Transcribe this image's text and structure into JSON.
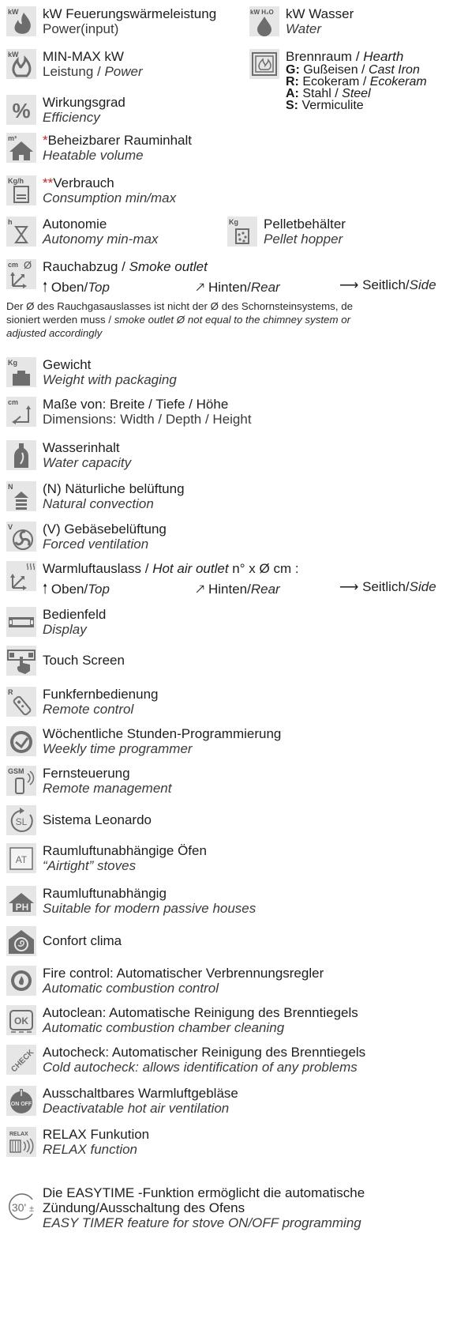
{
  "items": [
    {
      "title": "kW Feuerungswärmeleistung",
      "subtitle": "Power(input)",
      "icon": "flame-icon"
    },
    {
      "title": "MIN-MAX kW",
      "subtitle_a": "Leistung / ",
      "subtitle_b": "Power",
      "icon": "flames-icon"
    },
    {
      "title": "Wirkungsgrad",
      "subtitle": "Efficiency",
      "icon": "percent-icon"
    },
    {
      "title_mark": "*",
      "title": "Beheizbarer Rauminhalt",
      "subtitle": "Heatable volume",
      "icon": "house-icon"
    },
    {
      "title_mark": "**",
      "title": "Verbrauch",
      "subtitle": "Consumption min/max",
      "icon": "consumption-icon"
    },
    {
      "title": "Autonomie",
      "subtitle": "Autonomy min-max",
      "icon": "hourglass-icon"
    },
    {
      "title_a": "Rauchabzug / ",
      "title_b": "Smoke outlet",
      "icon": "smoke-outlet-icon"
    },
    {
      "title": "Gewicht",
      "subtitle": "Weight with packaging",
      "icon": "weight-icon"
    },
    {
      "title": "Maße von: Breite / Tiefe / Höhe",
      "subtitle": "Dimensions: Width / Depth / Height",
      "icon": "dimensions-icon"
    },
    {
      "title": "Wasserinhalt",
      "subtitle": "Water capacity",
      "icon": "water-bottle-icon"
    },
    {
      "title": "(N) Näturliche belüftung",
      "subtitle": "Natural convection",
      "icon": "natural-convection-icon"
    },
    {
      "title": "(V) Gebäsebelüftung",
      "subtitle": "Forced ventilation",
      "icon": "fan-icon"
    },
    {
      "title_a": "Warmluftauslass / ",
      "title_b": "Hot air outlet",
      "title_c": "  n° x Ø cm :",
      "icon": "hot-air-outlet-icon"
    },
    {
      "title": "Bedienfeld",
      "subtitle": "Display",
      "icon": "display-icon"
    },
    {
      "title": "Touch Screen",
      "icon": "touch-screen-icon"
    },
    {
      "title": "Funkfernbedienung",
      "subtitle": "Remote control",
      "icon": "remote-control-icon"
    },
    {
      "title": "Wöchentliche Stunden-Programmierung",
      "subtitle": "Weekly time programmer",
      "icon": "clock-icon"
    },
    {
      "title": "Fernsteuerung",
      "subtitle": "Remote management",
      "icon": "gsm-icon"
    },
    {
      "title": "Sistema Leonardo",
      "icon": "sl-icon"
    },
    {
      "title": "Raumluftunabhängige Öfen",
      "subtitle": "“Airtight” stoves",
      "icon": "airtight-icon"
    },
    {
      "title": "Raumluftunabhängig",
      "subtitle": "Suitable for modern passive houses",
      "icon": "passive-house-icon"
    },
    {
      "title": "Confort clima",
      "icon": "confort-clima-icon"
    },
    {
      "title": "Fire control: Automatischer Verbrennungsregler",
      "subtitle": "Automatic combustion control",
      "icon": "fire-control-icon"
    },
    {
      "title": "Autoclean: Automatische Reinigung des Brenntiegels",
      "subtitle": "Automatic combustion chamber cleaning",
      "icon": "autoclean-icon"
    },
    {
      "title": "Autocheck: Automatischer Reinigung des Brenntiegels",
      "subtitle": "Cold autocheck: allows identification of any problems",
      "icon": "autocheck-icon"
    },
    {
      "title": "Ausschaltbares Warmluftgebläse",
      "subtitle": "Deactivatable hot air ventilation",
      "icon": "on-off-icon"
    },
    {
      "title": "RELAX Funkution",
      "subtitle": "RELAX function",
      "icon": "relax-icon"
    },
    {
      "title": "Die EASYTIME -Funktion ermöglicht die automatische",
      "title2": "Zündung/Ausschaltung des Ofens",
      "subtitle": "EASY TIMER feature for stove ON/OFF programming",
      "icon": "timer-30-icon"
    }
  ],
  "right": {
    "water": {
      "title": "kW Wasser",
      "subtitle": "Water",
      "icon": "water-drop-icon"
    },
    "hearth": {
      "title_a": "Brennraum / ",
      "title_b": "Hearth",
      "icon": "hearth-icon",
      "materials": [
        {
          "code": "G:",
          "de": "Gußeisen / ",
          "en": "Cast Iron"
        },
        {
          "code": "R:",
          "de": "Ecokeram / ",
          "en": "Ecokeram"
        },
        {
          "code": "A:",
          "de": "Stahl / ",
          "en": "Steel"
        },
        {
          "code": "S:",
          "de": "Vermiculite",
          "en": ""
        }
      ]
    },
    "hopper": {
      "title": "Pelletbehälter",
      "subtitle": "Pellet hopper",
      "icon": "pellet-hopper-icon"
    }
  },
  "directions": {
    "top_de": "Oben/",
    "top_en": "Top",
    "rear_de": "Hinten/",
    "rear_en": "Rear",
    "side_de": "Seitlich/",
    "side_en": "Side"
  },
  "smoke_note": {
    "line1": "Der Ø des Rauchgasauslasses ist nicht der Ø des Schornsteinsystems, de",
    "line2_a": "sioniert werden muss / ",
    "line2_b": "smoke outlet Ø not equal to the chimney system or",
    "line3": "adjusted accordingly"
  },
  "icon_labels": {
    "kw": "kW",
    "kwh2o": "kW H₂O",
    "m3": "m³",
    "kgh": "Kg/h",
    "h": "h",
    "kg": "Kg",
    "cm": "cm",
    "phi": "Ø",
    "n": "N",
    "v": "V",
    "r": "R",
    "gsm": "GSM",
    "sl": "SL",
    "at": "AT",
    "ph": "PH",
    "ok": "OK",
    "check": "CHECK",
    "onoff": "ON OFF",
    "relax": "RELAX",
    "thirty": "30'",
    "pm": "±"
  },
  "colors": {
    "icon_bg": "#e6e6e6",
    "icon_fg": "#6d6d6d",
    "accent": "#d02020"
  }
}
